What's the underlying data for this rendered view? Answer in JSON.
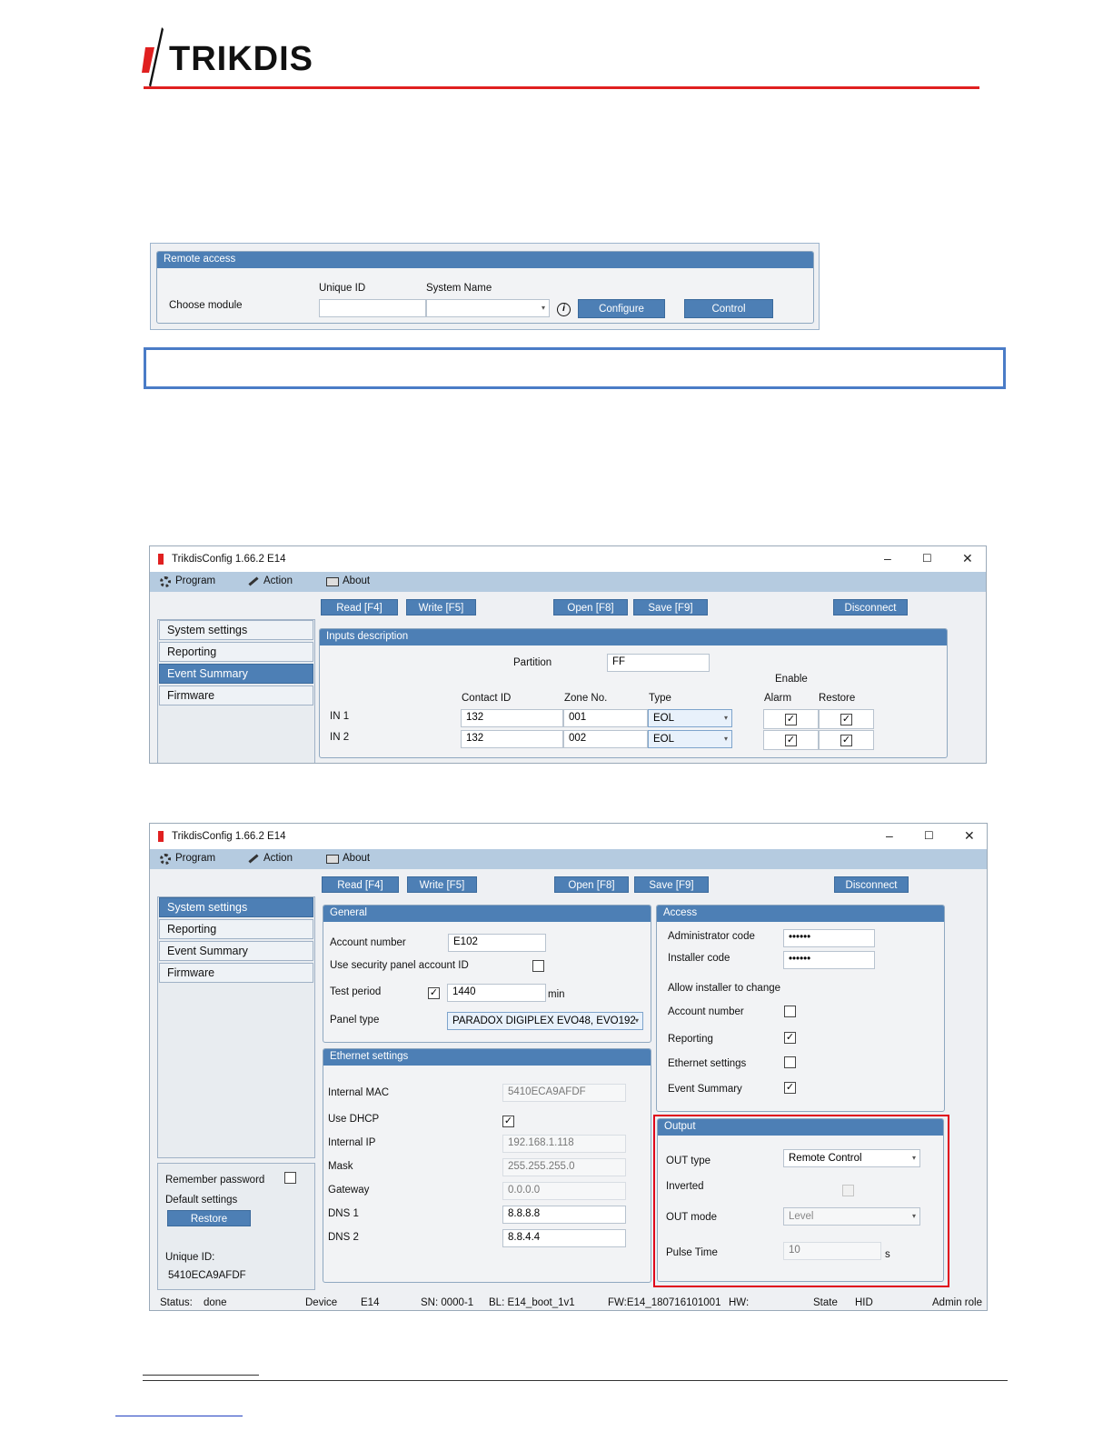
{
  "brand": {
    "logo_text": "TRIKDIS"
  },
  "remote_access": {
    "title": "Remote access",
    "choose_module": "Choose module",
    "unique_id_label": "Unique ID",
    "system_name_label": "System Name",
    "info_glyph": "i",
    "configure": "Configure",
    "control": "Control"
  },
  "window": {
    "title": "TrikdisConfig 1.66.2   E14",
    "menu": {
      "program": "Program",
      "action": "Action",
      "about": "About"
    },
    "toolbar": {
      "read": "Read [F4]",
      "write": "Write [F5]",
      "open": "Open [F8]",
      "save": "Save [F9]",
      "disconnect": "Disconnect"
    },
    "nav": [
      "System settings",
      "Reporting",
      "Event Summary",
      "Firmware"
    ],
    "controls": {
      "minimize": "–",
      "maximize": "☐",
      "close": "✕"
    }
  },
  "inputs_description": {
    "title": "Inputs description",
    "partition_label": "Partition",
    "partition_value": "FF",
    "enable_label": "Enable",
    "columns": {
      "contact_id": "Contact ID",
      "zone_no": "Zone No.",
      "type": "Type",
      "alarm": "Alarm",
      "restore": "Restore"
    },
    "rows": [
      {
        "name": "IN 1",
        "contact_id": "132",
        "zone_no": "001",
        "type": "EOL"
      },
      {
        "name": "IN 2",
        "contact_id": "132",
        "zone_no": "002",
        "type": "EOL"
      }
    ]
  },
  "general": {
    "title": "General",
    "account_number_label": "Account number",
    "account_number_value": "E102",
    "use_panel_account_label": "Use security panel account ID",
    "test_period_label": "Test period",
    "test_period_value": "1440",
    "test_period_unit": "min",
    "panel_type_label": "Panel type",
    "panel_type_value": "PARADOX DIGIPLEX EVO48, EVO192"
  },
  "ethernet": {
    "title": "Ethernet settings",
    "mac_label": "Internal MAC",
    "mac_value": "5410ECA9AFDF",
    "dhcp_label": "Use DHCP",
    "ip_label": "Internal IP",
    "ip_value": "192.168.1.118",
    "mask_label": "Mask",
    "mask_value": "255.255.255.0",
    "gateway_label": "Gateway",
    "gateway_value": "0.0.0.0",
    "dns1_label": "DNS 1",
    "dns1_value": "8.8.8.8",
    "dns2_label": "DNS 2",
    "dns2_value": "8.8.4.4"
  },
  "access": {
    "title": "Access",
    "admin_code_label": "Administrator code",
    "admin_code_value": "••••••",
    "installer_code_label": "Installer code",
    "installer_code_value": "••••••",
    "allow_installer_label": "Allow installer to change",
    "account_number_label": "Account number",
    "reporting_label": "Reporting",
    "ethernet_label": "Ethernet settings",
    "event_summary_label": "Event Summary"
  },
  "output": {
    "title": "Output",
    "out_type_label": "OUT type",
    "out_type_value": "Remote Control",
    "inverted_label": "Inverted",
    "out_mode_label": "OUT mode",
    "out_mode_value": "Level",
    "pulse_time_label": "Pulse Time",
    "pulse_time_value": "10",
    "pulse_time_unit": "s"
  },
  "sidebar_bottom": {
    "remember_password": "Remember password",
    "default_settings": "Default settings",
    "restore": "Restore",
    "unique_id_label": "Unique ID:",
    "unique_id_value": "5410ECA9AFDF"
  },
  "status_bar": {
    "status_label": "Status:",
    "status_value": "done",
    "device_label": "Device",
    "device_value": "E14",
    "sn": "SN: 0000-1",
    "bl": "BL:  E14_boot_1v1",
    "fw": "FW:E14_180716101001",
    "hw": "HW:",
    "state_label": "State",
    "state_value": "HID",
    "role": "Admin role"
  },
  "check_mark": "✓",
  "dropdown_arrow": "▾",
  "colors": {
    "accent": "#4d7fb5",
    "logo_red": "#e02020",
    "highlight_red": "#e0001a",
    "note_border": "#4a7cc7"
  }
}
